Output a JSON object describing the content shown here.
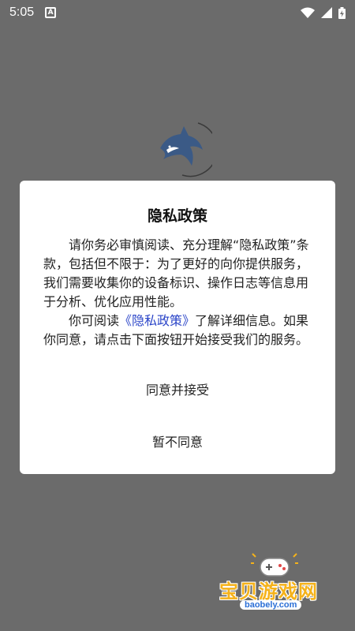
{
  "status_bar": {
    "time": "5:05",
    "icons": [
      "keyboard-a-icon",
      "wifi-icon",
      "signal-icon",
      "battery-icon"
    ]
  },
  "dialog": {
    "title": "隐私政策",
    "para1": "请你务必审慎阅读、充分理解“隐私政策”条款，包括但不限于：为了更好的向你提供服务，我们需要收集你的设备标识、操作日志等信息用于分析、优化应用性能。",
    "para2_before": "你可阅读",
    "para2_link": "《隐私政策》",
    "para2_after": "了解详细信息。如果你同意，请点击下面按钮开始接受我们的服务。",
    "accept_label": "同意并接受",
    "decline_label": "暂不同意"
  },
  "watermark": {
    "text": "宝贝游戏网",
    "url": "baobely.com"
  },
  "colors": {
    "overlay": "#6b6b6b",
    "link": "#2b45c8",
    "watermark": "#f5b21a"
  }
}
